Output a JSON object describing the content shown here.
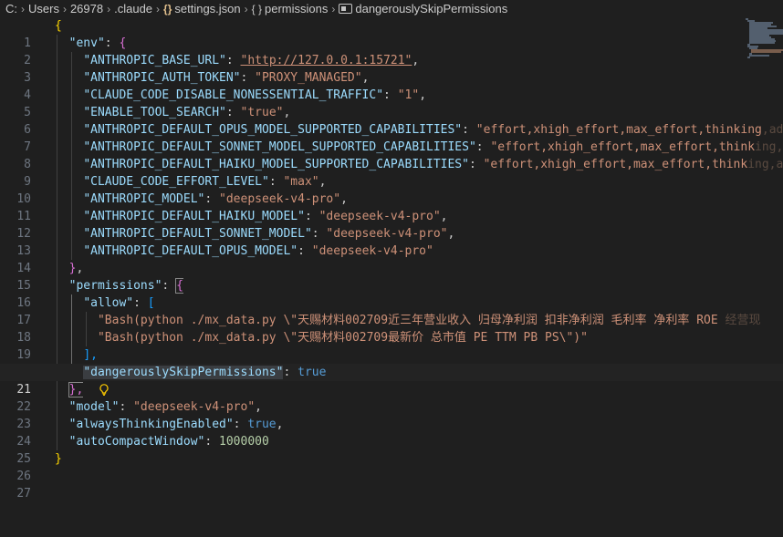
{
  "breadcrumb": {
    "drive": "C:",
    "users": "Users",
    "user": "26978",
    "folder": ".claude",
    "file_icon": "{}",
    "file": "settings.json",
    "obj_icon": "{ }",
    "object": "permissions",
    "property": "dangerouslySkipPermissions"
  },
  "lines": [
    {
      "n": "1",
      "t": "{"
    },
    {
      "n": "2",
      "t": "  \"env\": {"
    },
    {
      "n": "3",
      "key": "\"ANTHROPIC_BASE_URL\"",
      "val": "\"http://127.0.0.1:15721\""
    },
    {
      "n": "4",
      "key": "\"ANTHROPIC_AUTH_TOKEN\"",
      "val": "\"PROXY_MANAGED\""
    },
    {
      "n": "5",
      "key": "\"CLAUDE_CODE_DISABLE_NONESSENTIAL_TRAFFIC\"",
      "val": "\"1\""
    },
    {
      "n": "6",
      "key": "\"ENABLE_TOOL_SEARCH\"",
      "val": "\"true\""
    },
    {
      "n": "7",
      "key": "\"ANTHROPIC_DEFAULT_OPUS_MODEL_SUPPORTED_CAPABILITIES\"",
      "val": "\"effort,xhigh_effort,max_effort,thinking",
      "fade": ",adap"
    },
    {
      "n": "8",
      "key": "\"ANTHROPIC_DEFAULT_SONNET_MODEL_SUPPORTED_CAPABILITIES\"",
      "val": "\"effort,xhigh_effort,max_effort,think",
      "fade": "ing,ad"
    },
    {
      "n": "9",
      "key": "\"ANTHROPIC_DEFAULT_HAIKU_MODEL_SUPPORTED_CAPABILITIES\"",
      "val": "\"effort,xhigh_effort,max_effort,think",
      "fade": "ing,ada"
    },
    {
      "n": "10",
      "key": "\"CLAUDE_CODE_EFFORT_LEVEL\"",
      "val": "\"max\""
    },
    {
      "n": "11",
      "key": "\"ANTHROPIC_MODEL\"",
      "val": "\"deepseek-v4-pro\""
    },
    {
      "n": "12",
      "key": "\"ANTHROPIC_DEFAULT_HAIKU_MODEL\"",
      "val": "\"deepseek-v4-pro\""
    },
    {
      "n": "13",
      "key": "\"ANTHROPIC_DEFAULT_SONNET_MODEL\"",
      "val": "\"deepseek-v4-pro\""
    },
    {
      "n": "14",
      "key": "\"ANTHROPIC_DEFAULT_OPUS_MODEL\"",
      "val": "\"deepseek-v4-pro\""
    },
    {
      "n": "15",
      "t": "  },"
    },
    {
      "n": "16",
      "key": "\"permissions\""
    },
    {
      "n": "17",
      "key": "\"allow\""
    },
    {
      "n": "18",
      "val": "\"Bash(python ./mx_data.py \\\"天赐材料002709近三年营业收入 归母净利润 扣非净利润 毛利率 净利率 ROE",
      "fade": " 经营现"
    },
    {
      "n": "19",
      "val": "\"Bash(python ./mx_data.py \\\"天赐材料002709最新价 总市值 PE TTM PB PS\\\")\""
    },
    {
      "n": "20",
      "t": "],"
    },
    {
      "n": "21",
      "key": "\"dangerouslySkipPermissions\"",
      "val": "true"
    },
    {
      "n": "22",
      "t": "},"
    },
    {
      "n": "23",
      "key": "\"model\"",
      "val": "\"deepseek-v4-pro\""
    },
    {
      "n": "24",
      "key": "\"alwaysThinkingEnabled\"",
      "val": "true"
    },
    {
      "n": "25",
      "key": "\"autoCompactWindow\"",
      "val": "1000000"
    },
    {
      "n": "26",
      "t": "}"
    },
    {
      "n": "27",
      "t": ""
    }
  ],
  "colors": {
    "background": "#1f1f1f",
    "key": "#9cdcfe",
    "string": "#ce9178",
    "number": "#b5cea8",
    "boolean": "#569cd6",
    "bracket_level1": "#ffd700",
    "bracket_level2": "#da70d6",
    "bracket_level3": "#179fff",
    "lightbulb": "#ffcc00"
  }
}
